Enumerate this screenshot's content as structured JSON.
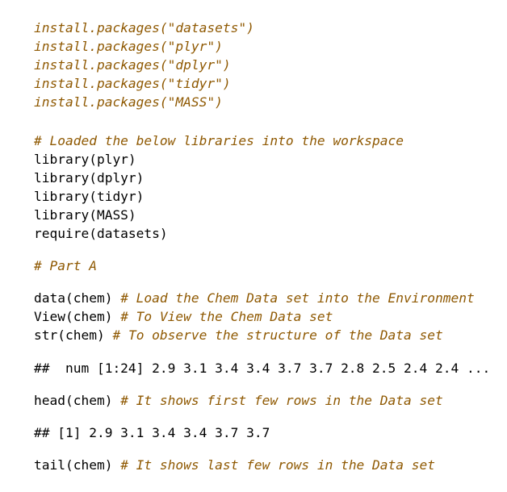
{
  "colors": {
    "comment": "#8f5902",
    "code": "#000000",
    "background": "#ffffff"
  },
  "lines": [
    {
      "code": "install.packages(\"datasets\")",
      "comment": "",
      "style": "italic-brown"
    },
    {
      "code": "install.packages(\"plyr\")",
      "comment": "",
      "style": "italic-brown"
    },
    {
      "code": "install.packages(\"dplyr\")",
      "comment": "",
      "style": "italic-brown"
    },
    {
      "code": "install.packages(\"tidyr\")",
      "comment": "",
      "style": "italic-brown"
    },
    {
      "code": "install.packages(\"MASS\")",
      "comment": "",
      "style": "italic-brown"
    },
    {
      "code": "",
      "comment": "# Loaded the below libraries into the workspace"
    },
    {
      "code": "library(plyr)",
      "comment": ""
    },
    {
      "code": "library(dplyr)",
      "comment": ""
    },
    {
      "code": "library(tidyr)",
      "comment": ""
    },
    {
      "code": "library(MASS)",
      "comment": ""
    },
    {
      "code": "require(datasets)",
      "comment": ""
    },
    {
      "code": "",
      "comment": "# Part A"
    },
    {
      "code": "data(chem) ",
      "comment": "# Load the Chem Data set into the Environment"
    },
    {
      "code": "View(chem) ",
      "comment": "# To View the Chem Data set"
    },
    {
      "code": "str(chem) ",
      "comment": "# To observe the structure of the Data set"
    },
    {
      "code": "##  num [1:24] 2.9 3.1 3.4 3.4 3.7 3.7 2.8 2.5 2.4 2.4 ...",
      "comment": ""
    },
    {
      "code": "head(chem) ",
      "comment": "# It shows first few rows in the Data set"
    },
    {
      "code": "## [1] 2.9 3.1 3.4 3.4 3.7 3.7",
      "comment": ""
    },
    {
      "code": "tail(chem) ",
      "comment": "# It shows last few rows in the Data set"
    }
  ]
}
